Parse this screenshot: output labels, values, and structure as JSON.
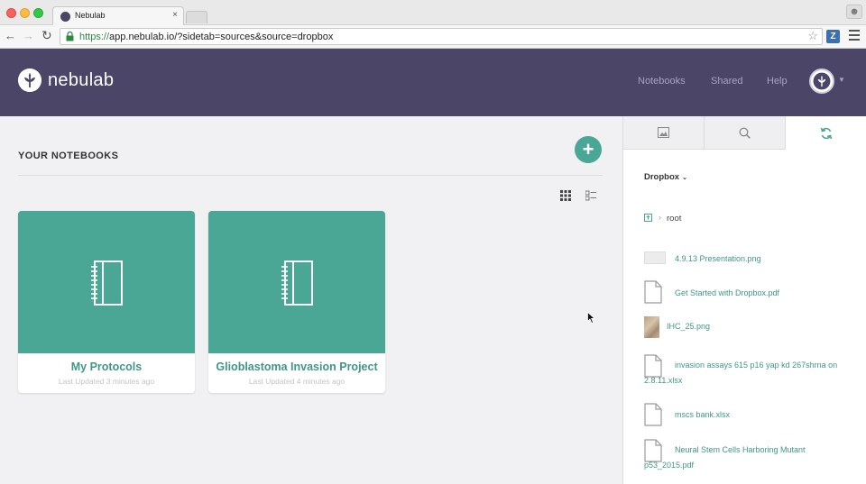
{
  "browser": {
    "tab_title": "Nebulab",
    "tab_close": "×",
    "url_scheme": "https://",
    "url_rest": "app.nebulab.io/?sidetab=sources&source=dropbox",
    "extension_label": "Z"
  },
  "header": {
    "logo_text": "nebulab",
    "nav": {
      "notebooks": "Notebooks",
      "shared": "Shared",
      "help": "Help"
    }
  },
  "main": {
    "section_title": "YOUR NOTEBOOKS",
    "add_label": "+",
    "notebooks": [
      {
        "name": "My Protocols",
        "updated": "Last Updated 3 minutes ago"
      },
      {
        "name": "Glioblastoma Invasion Project",
        "updated": "Last Updated 4 minutes ago"
      }
    ]
  },
  "side": {
    "tabs": [
      "images-icon",
      "search-icon",
      "sync-icon"
    ],
    "active_tab": 2,
    "source_label": "Dropbox",
    "breadcrumb_root": "root",
    "files": [
      {
        "name": "4.9.13 Presentation.png",
        "icon": "image-thumbnail"
      },
      {
        "name": "Get Started with Dropbox.pdf",
        "icon": "document-icon"
      },
      {
        "name": "IHC_25.png",
        "icon": "image-thumbnail"
      },
      {
        "name": "invasion assays 615 p16 yap kd 267shrna on 2.8.11.xlsx",
        "icon": "document-icon"
      },
      {
        "name": "mscs bank.xlsx",
        "icon": "document-icon"
      },
      {
        "name": "Neural Stem Cells Harboring Mutant p53_2015.pdf",
        "icon": "document-icon"
      }
    ]
  },
  "colors": {
    "header_bg": "#4b4567",
    "accent": "#4aa695",
    "link": "#3f9787"
  }
}
